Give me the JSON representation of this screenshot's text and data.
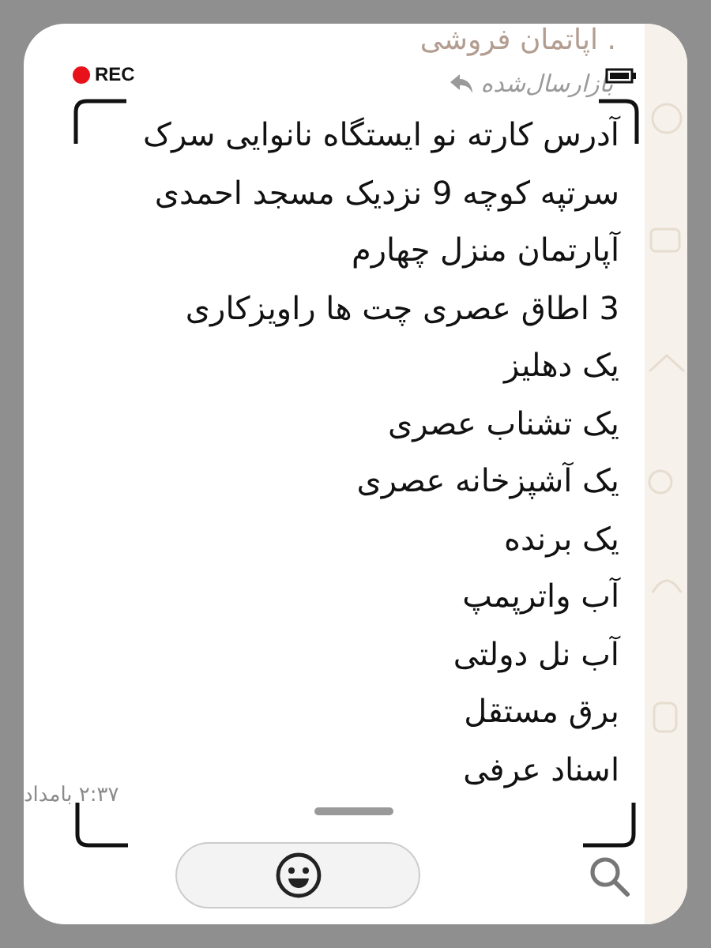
{
  "chat_title": ". اپاتمان فروشی",
  "recording": {
    "label": "REC"
  },
  "forwarded_label": "بازارسال‌شده",
  "message_lines": [
    "آدرس کارته نو ایستگاه نانوایی سرک",
    "سرتپه کوچه 9 نزدیک مسجد احمدی",
    "آپارتمان منزل چهارم",
    "3 اطاق عصری چت ها راویزکاری",
    "یک دهلیز",
    "یک تشناب عصری",
    "یک آشپزخانه عصری",
    "یک برنده",
    "آب واترپمپ",
    "آب نل دولتی",
    "برق مستقل",
    "اسناد عرفی"
  ],
  "time": "۲:۳۷ بامداد"
}
